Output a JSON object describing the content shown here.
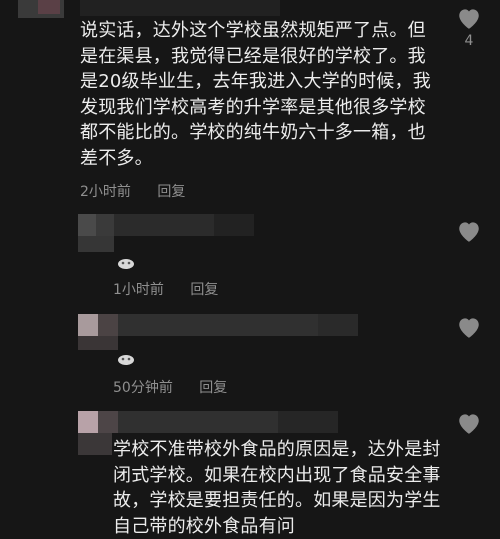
{
  "comments": [
    {
      "body": "说实话，达外这个学校虽然规矩严了点。但是在渠县，我觉得已经是很好的学校了。我是20级毕业生，去年我进入大学的时候，我发现我们学校高考的升学率是其他很多学校都不能比的。学校的纯牛奶六十多一箱，也差不多。",
      "time": "2小时前",
      "reply_label": "回复",
      "like_count": "4",
      "like_icon": "heart-icon"
    },
    {
      "body": "",
      "time": "1小时前",
      "reply_label": "回复",
      "like_icon": "heart-icon"
    },
    {
      "body": "",
      "time": "50分钟前",
      "reply_label": "回复",
      "like_icon": "heart-icon"
    },
    {
      "body": "学校不准带校外食品的原因是，达外是封闭式学校。如果在校内出现了食品安全事故，学校是要担责任的。如果是因为学生自己带的校外食品有问",
      "like_icon": "heart-icon"
    }
  ],
  "colors": {
    "background": "#161616",
    "text": "#ececec",
    "meta": "#8f8f8f",
    "heart": "#8a8a8a"
  }
}
